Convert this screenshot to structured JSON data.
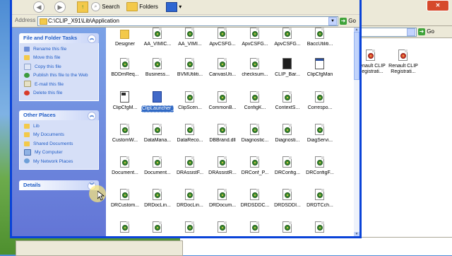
{
  "toolbar": {
    "search_label": "Search",
    "folders_label": "Folders"
  },
  "address": {
    "label": "Address",
    "path": "C:\\CLIP_X91\\Lib\\Application",
    "go_label": "Go"
  },
  "background_window": {
    "go_label": "Go",
    "icons": [
      {
        "label": "Renault CLIP Registrati..."
      },
      {
        "label": "Renault CLIP Registrati..."
      }
    ]
  },
  "task_pane": {
    "file_tasks": {
      "title": "File and Folder Tasks",
      "items": [
        {
          "label": "Rename this file",
          "icon": "rename-icon"
        },
        {
          "label": "Move this file",
          "icon": "move-icon"
        },
        {
          "label": "Copy this file",
          "icon": "copy-icon"
        },
        {
          "label": "Publish this file to the Web",
          "icon": "publish-icon"
        },
        {
          "label": "E-mail this file",
          "icon": "email-icon"
        },
        {
          "label": "Delete this file",
          "icon": "delete-icon"
        }
      ]
    },
    "other_places": {
      "title": "Other Places",
      "items": [
        {
          "label": "Lib",
          "icon": "folder-icon"
        },
        {
          "label": "My Documents",
          "icon": "my-documents-icon"
        },
        {
          "label": "Shared Documents",
          "icon": "shared-documents-icon"
        },
        {
          "label": "My Computer",
          "icon": "my-computer-icon"
        },
        {
          "label": "My Network Places",
          "icon": "network-places-icon"
        }
      ]
    },
    "details": {
      "title": "Details"
    }
  },
  "files": [
    {
      "label": "Designer",
      "icon": "folder-icon"
    },
    {
      "label": "AA_VIMIC...",
      "icon": "dll-icon"
    },
    {
      "label": "AA_VIMI...",
      "icon": "dll-icon"
    },
    {
      "label": "ApvCSFG...",
      "icon": "dll-icon"
    },
    {
      "label": "ApvCSFG...",
      "icon": "dll-icon"
    },
    {
      "label": "ApvCSFG...",
      "icon": "dll-icon"
    },
    {
      "label": "BaccUtiliti...",
      "icon": "dll-icon"
    },
    {
      "label": "BDDmReq...",
      "icon": "dll-icon"
    },
    {
      "label": "Business...",
      "icon": "dll-icon"
    },
    {
      "label": "BVMUtiliti...",
      "icon": "dll-icon"
    },
    {
      "label": "CanvasUti...",
      "icon": "dll-icon"
    },
    {
      "label": "checksum...",
      "icon": "dll-icon"
    },
    {
      "label": "CLIP_Bar...",
      "icon": "clip-icon"
    },
    {
      "label": "ClipCfgMan",
      "icon": "app-window-icon"
    },
    {
      "label": "ClipCfgM...",
      "icon": "config-icon"
    },
    {
      "label": "ClipLauncher_X91",
      "icon": "launcher-icon",
      "selected": true
    },
    {
      "label": "ClipScen...",
      "icon": "dll-icon"
    },
    {
      "label": "CommonB...",
      "icon": "dll-icon"
    },
    {
      "label": "ConfigK...",
      "icon": "dll-icon"
    },
    {
      "label": "ContextS...",
      "icon": "dll-icon"
    },
    {
      "label": "Correspo...",
      "icon": "dll-icon"
    },
    {
      "label": "CustomW...",
      "icon": "dll-icon"
    },
    {
      "label": "DataMana...",
      "icon": "dll-icon"
    },
    {
      "label": "DataReco...",
      "icon": "dll-icon"
    },
    {
      "label": "DBBrand.dll",
      "icon": "dll-icon"
    },
    {
      "label": "Diagnostic...",
      "icon": "dll-icon"
    },
    {
      "label": "Diagnosti...",
      "icon": "dll-icon"
    },
    {
      "label": "DiagServi...",
      "icon": "dll-icon"
    },
    {
      "label": "Document...",
      "icon": "dll-icon"
    },
    {
      "label": "Document...",
      "icon": "dll-icon"
    },
    {
      "label": "DRAssistF...",
      "icon": "dll-icon"
    },
    {
      "label": "DRAssistR...",
      "icon": "dll-icon"
    },
    {
      "label": "DRConf_P...",
      "icon": "dll-icon"
    },
    {
      "label": "DRConfig...",
      "icon": "dll-icon"
    },
    {
      "label": "DRConfigF...",
      "icon": "dll-icon"
    },
    {
      "label": "DRCustom...",
      "icon": "dll-icon"
    },
    {
      "label": "DRDocLin...",
      "icon": "dll-icon"
    },
    {
      "label": "DRDocLin...",
      "icon": "dll-icon"
    },
    {
      "label": "DRDocum...",
      "icon": "dll-icon"
    },
    {
      "label": "DRDSDDC...",
      "icon": "dll-icon"
    },
    {
      "label": "DRDSDDI...",
      "icon": "dll-icon"
    },
    {
      "label": "DRDTCch...",
      "icon": "dll-icon"
    },
    {
      "label": "",
      "icon": "dll-icon"
    },
    {
      "label": "",
      "icon": "dll-icon"
    },
    {
      "label": "",
      "icon": "dll-icon"
    },
    {
      "label": "",
      "icon": "dll-icon"
    },
    {
      "label": "",
      "icon": "dll-icon"
    },
    {
      "label": "",
      "icon": "dll-icon"
    },
    {
      "label": "",
      "icon": "dll-icon"
    }
  ]
}
